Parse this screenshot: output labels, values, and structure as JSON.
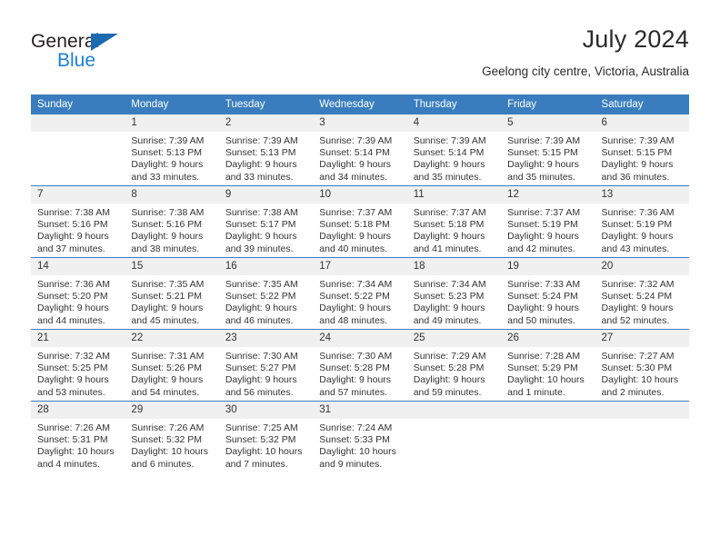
{
  "brand": {
    "name_top": "General",
    "name_bottom": "Blue",
    "accent_color": "#1b7fd4",
    "flag_color": "#1b6ab0"
  },
  "header": {
    "title": "July 2024",
    "subtitle": "Geelong city centre, Victoria, Australia"
  },
  "calendar": {
    "header_color": "#3a7dbf",
    "daynum_background": "#f0f0f0",
    "weekday_headers": [
      "Sunday",
      "Monday",
      "Tuesday",
      "Wednesday",
      "Thursday",
      "Friday",
      "Saturday"
    ],
    "weeks": [
      [
        {
          "day": "",
          "sunrise": "",
          "sunset": "",
          "daylight_line1": "",
          "daylight_line2": ""
        },
        {
          "day": "1",
          "sunrise": "Sunrise: 7:39 AM",
          "sunset": "Sunset: 5:13 PM",
          "daylight_line1": "Daylight: 9 hours",
          "daylight_line2": "and 33 minutes."
        },
        {
          "day": "2",
          "sunrise": "Sunrise: 7:39 AM",
          "sunset": "Sunset: 5:13 PM",
          "daylight_line1": "Daylight: 9 hours",
          "daylight_line2": "and 33 minutes."
        },
        {
          "day": "3",
          "sunrise": "Sunrise: 7:39 AM",
          "sunset": "Sunset: 5:14 PM",
          "daylight_line1": "Daylight: 9 hours",
          "daylight_line2": "and 34 minutes."
        },
        {
          "day": "4",
          "sunrise": "Sunrise: 7:39 AM",
          "sunset": "Sunset: 5:14 PM",
          "daylight_line1": "Daylight: 9 hours",
          "daylight_line2": "and 35 minutes."
        },
        {
          "day": "5",
          "sunrise": "Sunrise: 7:39 AM",
          "sunset": "Sunset: 5:15 PM",
          "daylight_line1": "Daylight: 9 hours",
          "daylight_line2": "and 35 minutes."
        },
        {
          "day": "6",
          "sunrise": "Sunrise: 7:39 AM",
          "sunset": "Sunset: 5:15 PM",
          "daylight_line1": "Daylight: 9 hours",
          "daylight_line2": "and 36 minutes."
        }
      ],
      [
        {
          "day": "7",
          "sunrise": "Sunrise: 7:38 AM",
          "sunset": "Sunset: 5:16 PM",
          "daylight_line1": "Daylight: 9 hours",
          "daylight_line2": "and 37 minutes."
        },
        {
          "day": "8",
          "sunrise": "Sunrise: 7:38 AM",
          "sunset": "Sunset: 5:16 PM",
          "daylight_line1": "Daylight: 9 hours",
          "daylight_line2": "and 38 minutes."
        },
        {
          "day": "9",
          "sunrise": "Sunrise: 7:38 AM",
          "sunset": "Sunset: 5:17 PM",
          "daylight_line1": "Daylight: 9 hours",
          "daylight_line2": "and 39 minutes."
        },
        {
          "day": "10",
          "sunrise": "Sunrise: 7:37 AM",
          "sunset": "Sunset: 5:18 PM",
          "daylight_line1": "Daylight: 9 hours",
          "daylight_line2": "and 40 minutes."
        },
        {
          "day": "11",
          "sunrise": "Sunrise: 7:37 AM",
          "sunset": "Sunset: 5:18 PM",
          "daylight_line1": "Daylight: 9 hours",
          "daylight_line2": "and 41 minutes."
        },
        {
          "day": "12",
          "sunrise": "Sunrise: 7:37 AM",
          "sunset": "Sunset: 5:19 PM",
          "daylight_line1": "Daylight: 9 hours",
          "daylight_line2": "and 42 minutes."
        },
        {
          "day": "13",
          "sunrise": "Sunrise: 7:36 AM",
          "sunset": "Sunset: 5:19 PM",
          "daylight_line1": "Daylight: 9 hours",
          "daylight_line2": "and 43 minutes."
        }
      ],
      [
        {
          "day": "14",
          "sunrise": "Sunrise: 7:36 AM",
          "sunset": "Sunset: 5:20 PM",
          "daylight_line1": "Daylight: 9 hours",
          "daylight_line2": "and 44 minutes."
        },
        {
          "day": "15",
          "sunrise": "Sunrise: 7:35 AM",
          "sunset": "Sunset: 5:21 PM",
          "daylight_line1": "Daylight: 9 hours",
          "daylight_line2": "and 45 minutes."
        },
        {
          "day": "16",
          "sunrise": "Sunrise: 7:35 AM",
          "sunset": "Sunset: 5:22 PM",
          "daylight_line1": "Daylight: 9 hours",
          "daylight_line2": "and 46 minutes."
        },
        {
          "day": "17",
          "sunrise": "Sunrise: 7:34 AM",
          "sunset": "Sunset: 5:22 PM",
          "daylight_line1": "Daylight: 9 hours",
          "daylight_line2": "and 48 minutes."
        },
        {
          "day": "18",
          "sunrise": "Sunrise: 7:34 AM",
          "sunset": "Sunset: 5:23 PM",
          "daylight_line1": "Daylight: 9 hours",
          "daylight_line2": "and 49 minutes."
        },
        {
          "day": "19",
          "sunrise": "Sunrise: 7:33 AM",
          "sunset": "Sunset: 5:24 PM",
          "daylight_line1": "Daylight: 9 hours",
          "daylight_line2": "and 50 minutes."
        },
        {
          "day": "20",
          "sunrise": "Sunrise: 7:32 AM",
          "sunset": "Sunset: 5:24 PM",
          "daylight_line1": "Daylight: 9 hours",
          "daylight_line2": "and 52 minutes."
        }
      ],
      [
        {
          "day": "21",
          "sunrise": "Sunrise: 7:32 AM",
          "sunset": "Sunset: 5:25 PM",
          "daylight_line1": "Daylight: 9 hours",
          "daylight_line2": "and 53 minutes."
        },
        {
          "day": "22",
          "sunrise": "Sunrise: 7:31 AM",
          "sunset": "Sunset: 5:26 PM",
          "daylight_line1": "Daylight: 9 hours",
          "daylight_line2": "and 54 minutes."
        },
        {
          "day": "23",
          "sunrise": "Sunrise: 7:30 AM",
          "sunset": "Sunset: 5:27 PM",
          "daylight_line1": "Daylight: 9 hours",
          "daylight_line2": "and 56 minutes."
        },
        {
          "day": "24",
          "sunrise": "Sunrise: 7:30 AM",
          "sunset": "Sunset: 5:28 PM",
          "daylight_line1": "Daylight: 9 hours",
          "daylight_line2": "and 57 minutes."
        },
        {
          "day": "25",
          "sunrise": "Sunrise: 7:29 AM",
          "sunset": "Sunset: 5:28 PM",
          "daylight_line1": "Daylight: 9 hours",
          "daylight_line2": "and 59 minutes."
        },
        {
          "day": "26",
          "sunrise": "Sunrise: 7:28 AM",
          "sunset": "Sunset: 5:29 PM",
          "daylight_line1": "Daylight: 10 hours",
          "daylight_line2": "and 1 minute."
        },
        {
          "day": "27",
          "sunrise": "Sunrise: 7:27 AM",
          "sunset": "Sunset: 5:30 PM",
          "daylight_line1": "Daylight: 10 hours",
          "daylight_line2": "and 2 minutes."
        }
      ],
      [
        {
          "day": "28",
          "sunrise": "Sunrise: 7:26 AM",
          "sunset": "Sunset: 5:31 PM",
          "daylight_line1": "Daylight: 10 hours",
          "daylight_line2": "and 4 minutes."
        },
        {
          "day": "29",
          "sunrise": "Sunrise: 7:26 AM",
          "sunset": "Sunset: 5:32 PM",
          "daylight_line1": "Daylight: 10 hours",
          "daylight_line2": "and 6 minutes."
        },
        {
          "day": "30",
          "sunrise": "Sunrise: 7:25 AM",
          "sunset": "Sunset: 5:32 PM",
          "daylight_line1": "Daylight: 10 hours",
          "daylight_line2": "and 7 minutes."
        },
        {
          "day": "31",
          "sunrise": "Sunrise: 7:24 AM",
          "sunset": "Sunset: 5:33 PM",
          "daylight_line1": "Daylight: 10 hours",
          "daylight_line2": "and 9 minutes."
        },
        {
          "day": "",
          "sunrise": "",
          "sunset": "",
          "daylight_line1": "",
          "daylight_line2": ""
        },
        {
          "day": "",
          "sunrise": "",
          "sunset": "",
          "daylight_line1": "",
          "daylight_line2": ""
        },
        {
          "day": "",
          "sunrise": "",
          "sunset": "",
          "daylight_line1": "",
          "daylight_line2": ""
        }
      ]
    ]
  }
}
